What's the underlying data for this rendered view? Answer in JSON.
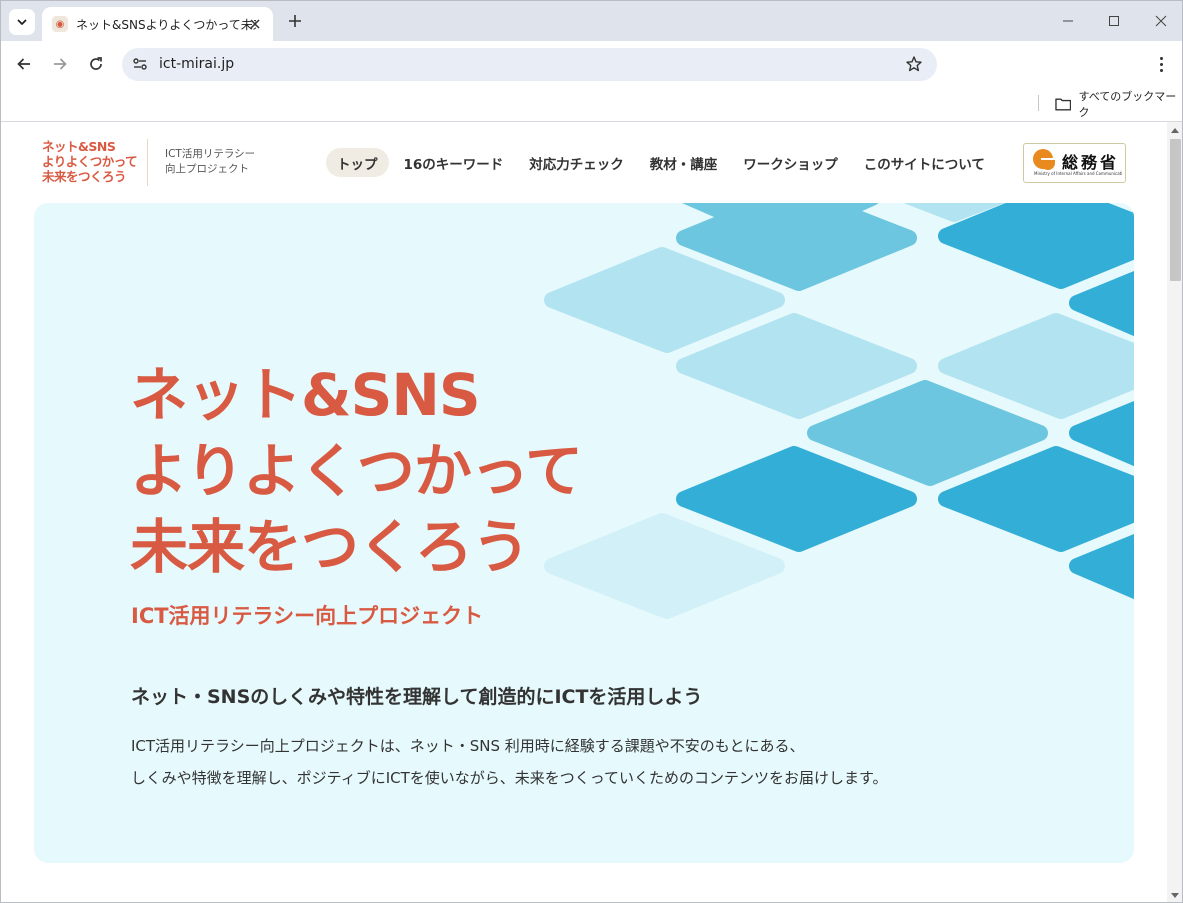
{
  "browser": {
    "tab": {
      "title": "ネット&SNSよりよくつかって未来をつくろう",
      "favicon": "logo-favicon"
    },
    "omnibox": {
      "url": "ict-mirai.jp"
    },
    "bookmarks": {
      "all_label": "すべてのブックマーク"
    }
  },
  "site": {
    "logo_lines": [
      "ネット&SNS",
      "よりよくつかって",
      "未来をつくろう"
    ],
    "logo_sub_lines": [
      "ICT活用リテラシー",
      "向上プロジェクト"
    ],
    "nav": [
      {
        "label": "トップ",
        "active": true
      },
      {
        "label": "16のキーワード",
        "active": false
      },
      {
        "label": "対応力チェック",
        "active": false
      },
      {
        "label": "教材・講座",
        "active": false
      },
      {
        "label": "ワークショップ",
        "active": false
      },
      {
        "label": "このサイトについて",
        "active": false
      }
    ],
    "ministry": {
      "name": "総務省",
      "english": "Ministry of Internal Affairs and Communications"
    }
  },
  "hero": {
    "title_lines": [
      "ネット&SNS",
      "よりよくつかって",
      "未来をつくろう"
    ],
    "subtitle": "ICT活用リテラシー向上プロジェクト",
    "lead": "ネット・SNSのしくみや特性を理解して創造的にICTを活用しよう",
    "description_lines": [
      "ICT活用リテラシー向上プロジェクトは、ネット・SNS 利用時に経験する課題や不安のもとにある、",
      "しくみや特徴を理解し、ポジティブにICTを使いながら、未来をつくっていくためのコンテンツをお届けします。"
    ]
  },
  "colors": {
    "accent": "#d95a42",
    "hero_bg": "#e6f9fc",
    "tile_dark": "#33aed6",
    "tile_mid": "#6cc6df",
    "tile_light": "#b2e3f0",
    "tile_pale": "#d2f0f7"
  }
}
